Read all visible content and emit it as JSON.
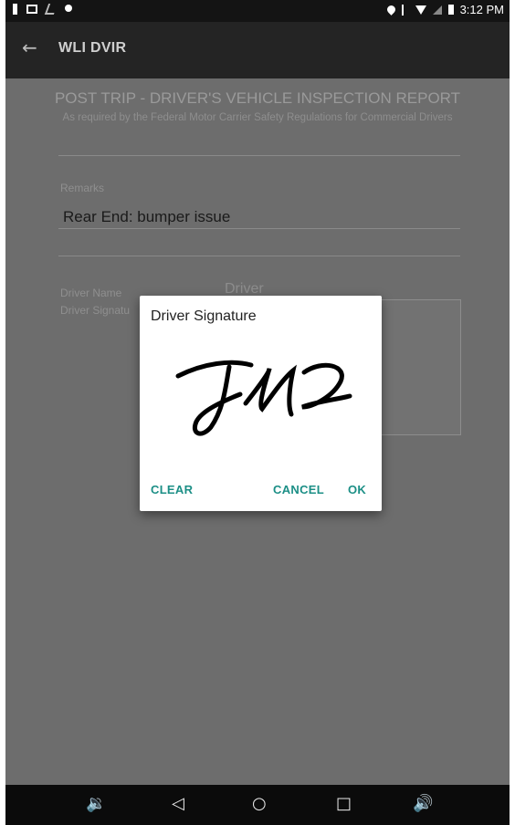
{
  "status_bar": {
    "time": "3:12 PM"
  },
  "app_bar": {
    "title": "WLI DVIR"
  },
  "report": {
    "title": "POST TRIP - DRIVER'S VEHICLE INSPECTION REPORT",
    "subtitle": "As required by the Federal Motor Carrier Safety Regulations for Commercial Drivers"
  },
  "form": {
    "remarks_label": "Remarks",
    "remarks_value": "Rear End: bumper issue",
    "driver_name_label": "Driver Name",
    "driver_name_value": "Driver",
    "driver_signature_label": "Driver Signatu"
  },
  "dialog": {
    "title": "Driver Signature",
    "clear_label": "CLEAR",
    "cancel_label": "CANCEL",
    "ok_label": "OK"
  },
  "icons": {
    "back": "arrow-left-icon",
    "nav": [
      "volume-down-icon",
      "back-triangle-icon",
      "home-circle-icon",
      "recents-square-icon",
      "volume-up-icon"
    ]
  },
  "colors": {
    "accent": "#1c8f86",
    "app_bar": "#242424",
    "scrim": "#6d6d6d"
  }
}
